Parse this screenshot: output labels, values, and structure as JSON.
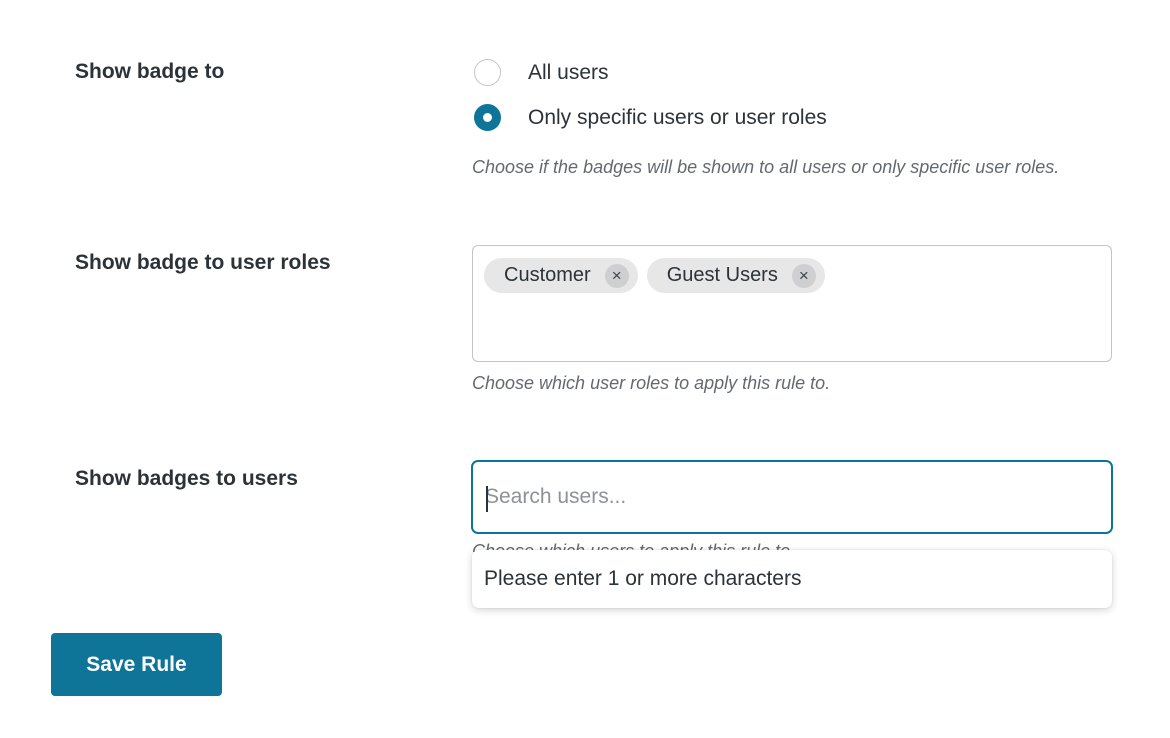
{
  "show_badge_to": {
    "label": "Show badge to",
    "options": [
      {
        "label": "All users",
        "checked": false
      },
      {
        "label": "Only specific users or user roles",
        "checked": true
      }
    ],
    "description": "Choose if the badges will be shown to all users or only specific user roles."
  },
  "user_roles": {
    "label": "Show badge to user roles",
    "chips": [
      {
        "label": "Customer",
        "remove_glyph": "×"
      },
      {
        "label": "Guest Users",
        "remove_glyph": "×"
      }
    ],
    "description": "Choose which user roles to apply this rule to."
  },
  "users": {
    "label": "Show badges to users",
    "search_placeholder": "Search users...",
    "search_value": "",
    "description": "Choose which users to apply this rule to.",
    "dropdown_message": "Please enter 1 or more characters"
  },
  "actions": {
    "save_label": "Save Rule"
  },
  "colors": {
    "accent": "#0e7599",
    "chip_bg": "#e7e7e8"
  }
}
